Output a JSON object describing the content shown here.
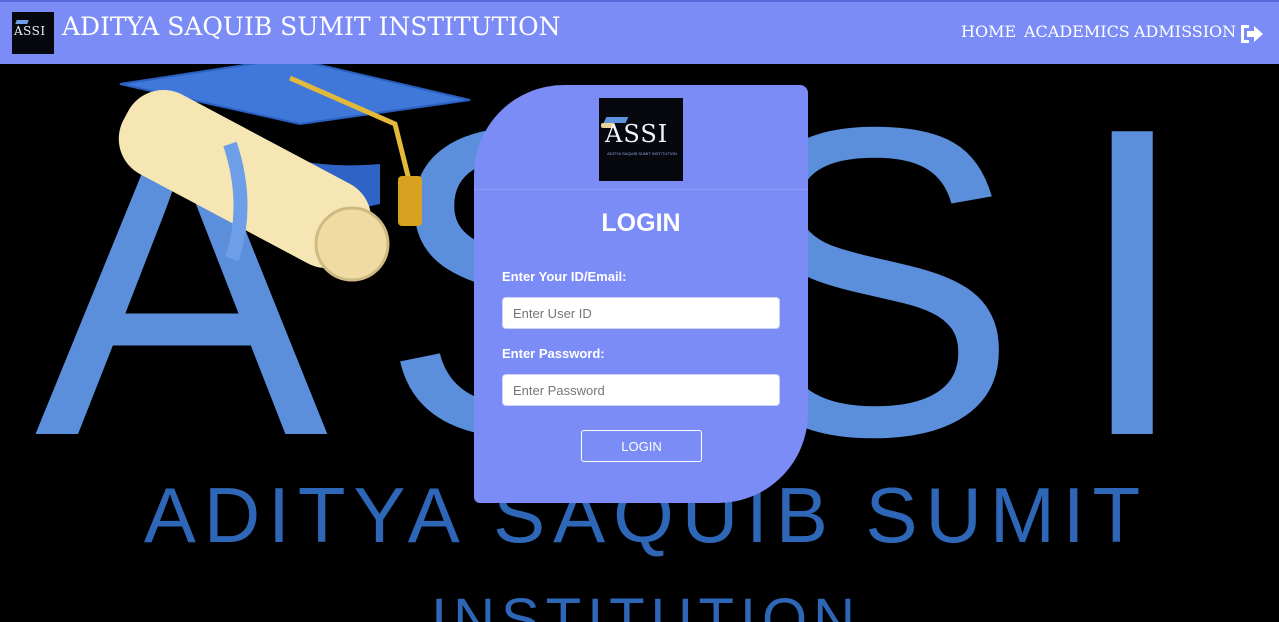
{
  "header": {
    "logo_text": "ASSI",
    "title": "ADITYA SAQUIB SUMIT INSTITUTION",
    "nav": {
      "home": "HOME",
      "academics": "ACADEMICS",
      "admission": "ADMISSION"
    },
    "logout_icon": "sign-out-icon"
  },
  "background": {
    "logo_letters": "ASSI",
    "line1": "ADITYA SAQUIB SUMIT",
    "line2": "INSTITUTION"
  },
  "login": {
    "logo_letters": "ASSI",
    "logo_subtext": "ADITYA SAQUIB SUMIT INSTITUTION",
    "title": "LOGIN",
    "id_label": "Enter Your ID/Email:",
    "id_placeholder": "Enter User ID",
    "password_label": "Enter Password:",
    "password_placeholder": "Enter Password",
    "button_label": "LOGIN"
  },
  "colors": {
    "header_bg": "#7b8cf7",
    "card_bg": "#7b8cf7",
    "background_text": "#5b8fdc",
    "page_bg": "#000000"
  }
}
